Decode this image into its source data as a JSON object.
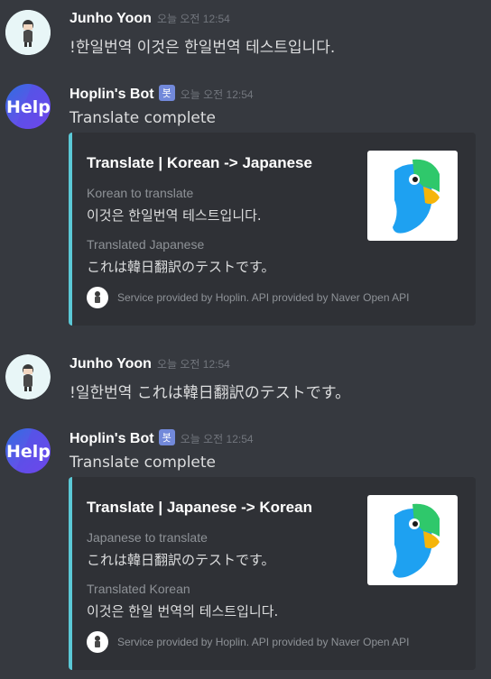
{
  "messages": [
    {
      "author": "Junho Yoon",
      "timestamp": "오늘 오전 12:54",
      "text": "!한일번역 이것은 한일번역 테스트입니다."
    },
    {
      "author": "Hoplin's Bot",
      "badge": "봇",
      "timestamp": "오늘 오전 12:54",
      "text": "Translate complete",
      "embed": {
        "title": "Translate | Korean -> Japanese",
        "field1_name": "Korean to translate",
        "field1_value": "이것은 한일번역 테스트입니다.",
        "field2_name": "Translated Japanese",
        "field2_value": "これは韓日翻訳のテストです。",
        "footer": "Service provided by Hoplin. API provided by Naver Open API"
      }
    },
    {
      "author": "Junho Yoon",
      "timestamp": "오늘 오전 12:54",
      "text": "!일한번역 これは韓日翻訳のテストです。"
    },
    {
      "author": "Hoplin's Bot",
      "badge": "봇",
      "timestamp": "오늘 오전 12:54",
      "text": "Translate complete",
      "embed": {
        "title": "Translate | Japanese -> Korean",
        "field1_name": "Japanese to translate",
        "field1_value": "これは韓日翻訳のテストです。",
        "field2_name": "Translated Korean",
        "field2_value": "이것은 한일 번역의 테스트입니다.",
        "footer": "Service provided by Hoplin. API provided by Naver Open API"
      }
    }
  ],
  "colors": {
    "background": "#36393f",
    "embed_background": "#2f3136",
    "embed_accent": "#5bc8d6",
    "bot_badge": "#7289da",
    "timestamp": "#72767d"
  },
  "icons": {
    "user_avatar": "user-avatar-icon",
    "bot_avatar": "help-logo-avatar",
    "embed_thumbnail": "papago-parrot-icon"
  }
}
